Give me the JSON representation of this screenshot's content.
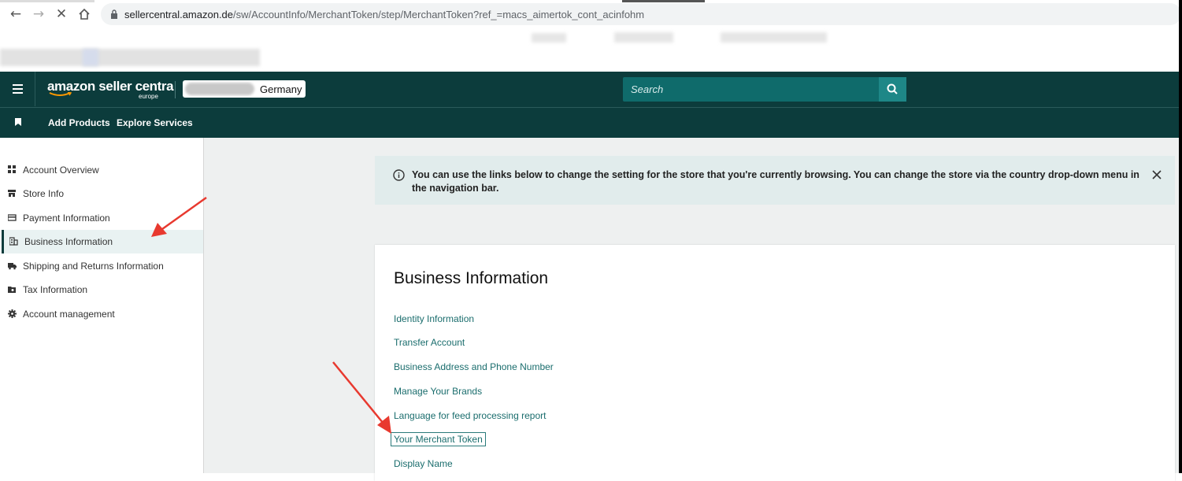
{
  "browser": {
    "url_host": "sellercentral.amazon.de",
    "url_path": "/sw/AccountInfo/MerchantToken/step/MerchantToken?ref_=macs_aimertok_cont_acinfohm"
  },
  "header": {
    "logo_text": "amazon seller centra",
    "logo_sub": "europe",
    "store_label": "Germany",
    "search_placeholder": "Search"
  },
  "subnav": {
    "items": [
      "Add Products",
      "Explore Services"
    ]
  },
  "sidebar": {
    "items": [
      {
        "label": "Account Overview",
        "icon": "grid-icon"
      },
      {
        "label": "Store Info",
        "icon": "store-icon"
      },
      {
        "label": "Payment Information",
        "icon": "card-icon"
      },
      {
        "label": "Business Information",
        "icon": "building-icon",
        "active": true
      },
      {
        "label": "Shipping and Returns Information",
        "icon": "truck-icon"
      },
      {
        "label": "Tax Information",
        "icon": "folder-icon"
      },
      {
        "label": "Account management",
        "icon": "gear-icon"
      }
    ]
  },
  "banner": {
    "text": "You can use the links below to change the setting for the store that you're currently browsing. You can change the store via the country drop-down menu in the navigation bar."
  },
  "card": {
    "title": "Business Information",
    "links": [
      "Identity Information",
      "Transfer Account",
      "Business Address and Phone Number",
      "Manage Your Brands",
      "Language for feed processing report",
      "Your Merchant Token",
      "Display Name"
    ]
  },
  "colors": {
    "header_bg": "#0c3c3c",
    "search_bg": "#0f6b6b",
    "link": "#1a6d6d",
    "annotation_arrow": "#e8392f"
  }
}
